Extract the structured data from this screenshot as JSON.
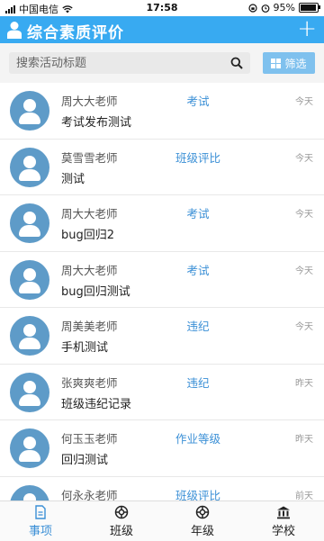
{
  "status_bar": {
    "carrier": "中国电信",
    "time": "17:58",
    "battery": "95%",
    "battery_level": 0.95
  },
  "header": {
    "title": "综合素质评价",
    "add_label": "+",
    "user_icon": "user-icon"
  },
  "search": {
    "placeholder": "搜索活动标题",
    "filter_label": "筛选"
  },
  "items": [
    {
      "teacher": "周大大老师",
      "category": "考试",
      "date": "今天",
      "title": "考试发布测试"
    },
    {
      "teacher": "莫雪雪老师",
      "category": "班级评比",
      "date": "今天",
      "title": "测试"
    },
    {
      "teacher": "周大大老师",
      "category": "考试",
      "date": "今天",
      "title": "bug回归2"
    },
    {
      "teacher": "周大大老师",
      "category": "考试",
      "date": "今天",
      "title": "bug回归测试"
    },
    {
      "teacher": "周美美老师",
      "category": "违纪",
      "date": "今天",
      "title": "手机测试"
    },
    {
      "teacher": "张爽爽老师",
      "category": "违纪",
      "date": "昨天",
      "title": "班级违纪记录"
    },
    {
      "teacher": "何玉玉老师",
      "category": "作业等级",
      "date": "昨天",
      "title": "回归测试"
    },
    {
      "teacher": "何永永老师",
      "category": "班级评比",
      "date": "前天",
      "title": ""
    }
  ],
  "tabs": [
    {
      "label": "事项",
      "icon": "document-icon",
      "active": true
    },
    {
      "label": "班级",
      "icon": "lifebuoy-icon",
      "active": false
    },
    {
      "label": "年级",
      "icon": "lifebuoy-icon",
      "active": false
    },
    {
      "label": "学校",
      "icon": "building-icon",
      "active": false
    }
  ],
  "colors": {
    "header_bg": "#38aaf1",
    "accent": "#3a8fd6",
    "avatar_bg": "#5e9bc8",
    "filter_bg": "#7fc1ee"
  }
}
